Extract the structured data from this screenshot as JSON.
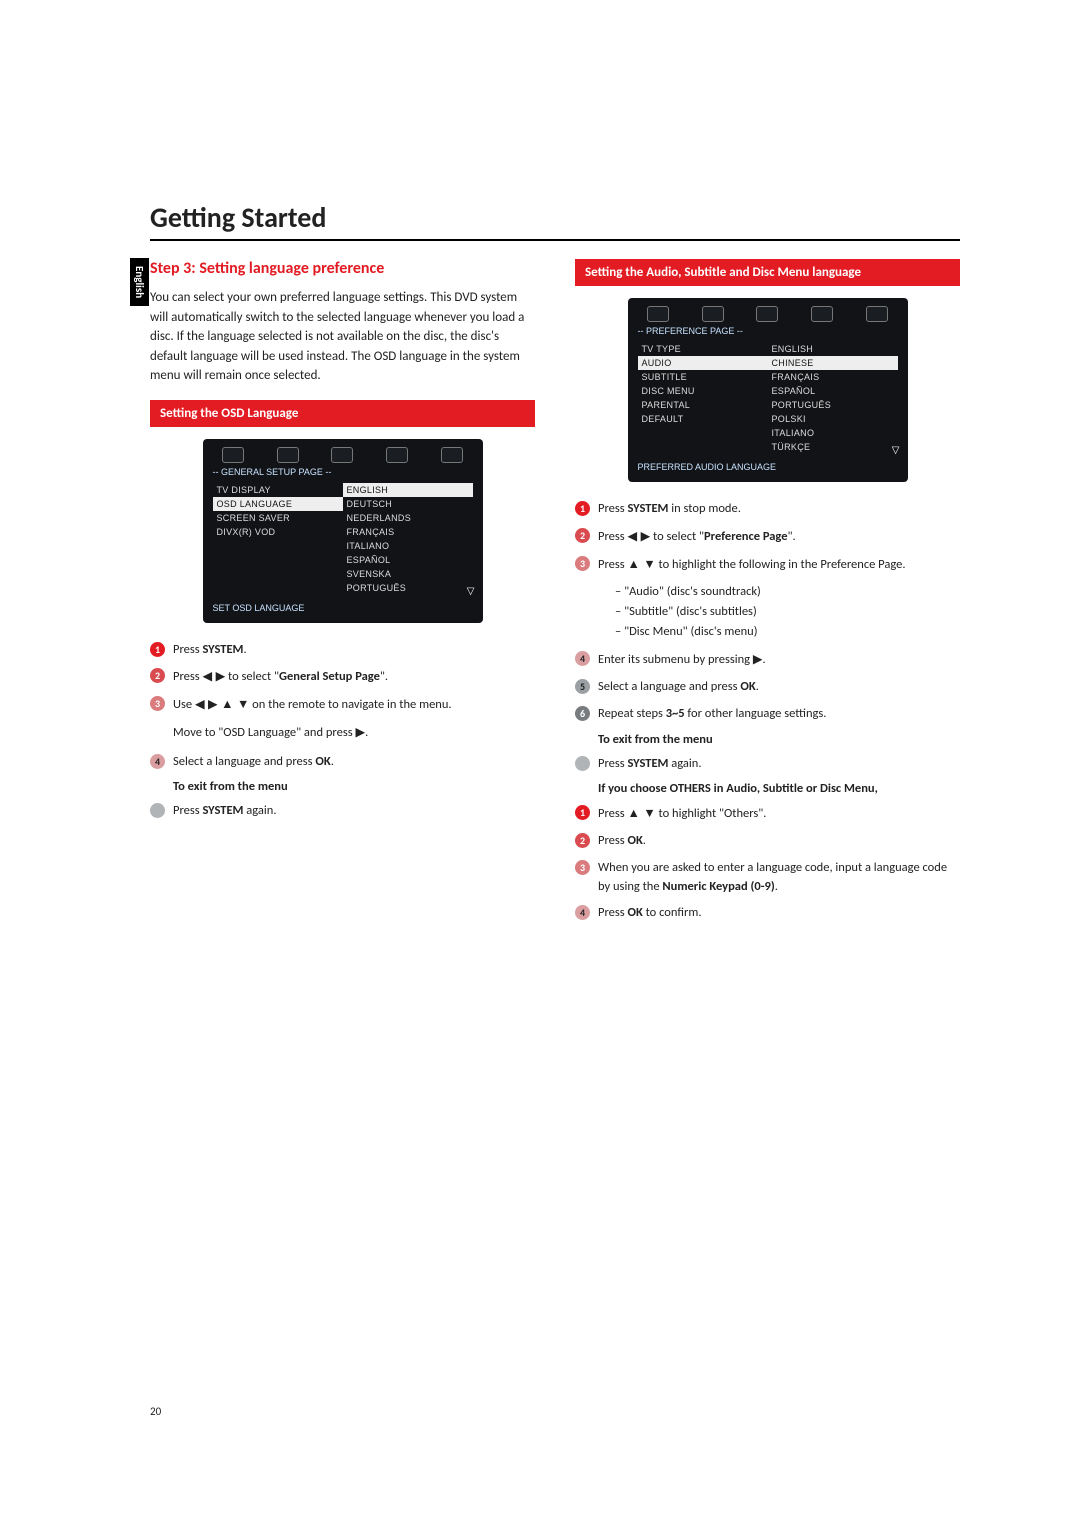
{
  "title": "Getting Started",
  "side_tab": "English",
  "page_number": "20",
  "left": {
    "step_heading": "Step 3:   Setting language preference",
    "intro": "You can select your own preferred language settings. This DVD system will automatically switch to the selected language whenever you load a disc. If the language selected is not available on the disc, the disc's default language will be used instead. The OSD language in the system menu will remain once selected.",
    "subhead": "Setting the OSD Language",
    "menu": {
      "title": "-- GENERAL SETUP PAGE --",
      "items": [
        "TV DISPLAY",
        "OSD LANGUAGE",
        "SCREEN SAVER",
        "DIVX(R) VOD"
      ],
      "highlighted_item": "OSD LANGUAGE",
      "langs": [
        "ENGLISH",
        "DEUTSCH",
        "NEDERLANDS",
        "FRANÇAIS",
        "ITALIANO",
        "ESPAÑOL",
        "SVENSKA",
        "PORTUGUÊS"
      ],
      "highlighted_lang": "ENGLISH",
      "footer": "SET OSD LANGUAGE"
    },
    "s1": "Press <b>SYSTEM</b>.",
    "s2": "Press <span class='arrow'>◀ ▶</span> to select \"<b>General Setup Page</b>\".",
    "s3": "Use <span class='arrow'>◀ ▶ ▲ ▼</span> on the remote to navigate in the menu.",
    "s3b": "Move to \"OSD Language\" and press <span class='arrow'>▶</span>.",
    "s4": "Select a language and press <b>OK</b>.",
    "exit_label": "To exit from the menu",
    "exit_step": "Press <b>SYSTEM</b> again."
  },
  "right": {
    "subhead": "Setting the Audio, Subtitle and Disc Menu language",
    "menu": {
      "title": "-- PREFERENCE PAGE --",
      "items": [
        "TV TYPE",
        "AUDIO",
        "SUBTITLE",
        "DISC MENU",
        "PARENTAL",
        "DEFAULT"
      ],
      "highlighted_item": "AUDIO",
      "langs": [
        "ENGLISH",
        "CHINESE",
        "FRANÇAIS",
        "ESPAÑOL",
        "PORTUGUÊS",
        "POLSKI",
        "ITALIANO",
        "TÜRKÇE"
      ],
      "highlighted_lang": "CHINESE",
      "footer": "PREFERRED AUDIO LANGUAGE"
    },
    "s1": "Press <b>SYSTEM</b> in stop mode.",
    "s2": "Press <span class='arrow'>◀ ▶</span> to select \"<b>Preference Page</b>\".",
    "s3": "Press <span class='arrow'>▲ ▼</span> to highlight the following in the Preference Page.",
    "s3_sub": [
      "\"Audio\" (disc's soundtrack)",
      "\"Subtitle\" (disc's subtitles)",
      "\"Disc Menu\" (disc's menu)"
    ],
    "s4": "Enter its submenu by pressing <span class='arrow'>▶</span>.",
    "s5": "Select a language and press <b>OK</b>.",
    "s6": "Repeat steps <b>3~5</b> for other language settings.",
    "exit_label": "To exit from the menu",
    "exit_step": "Press <b>SYSTEM</b> again.",
    "others_heading": "If you choose OTHERS in Audio, Subtitle or Disc Menu,",
    "o1": "Press <span class='arrow'>▲ ▼</span> to highlight \"Others\".",
    "o2": "Press <b>OK</b>.",
    "o3": "When you are asked to enter a language code, input a language code by using the <b>Numeric Keypad (0-9)</b>.",
    "o4": "Press <b>OK</b> to confirm."
  }
}
